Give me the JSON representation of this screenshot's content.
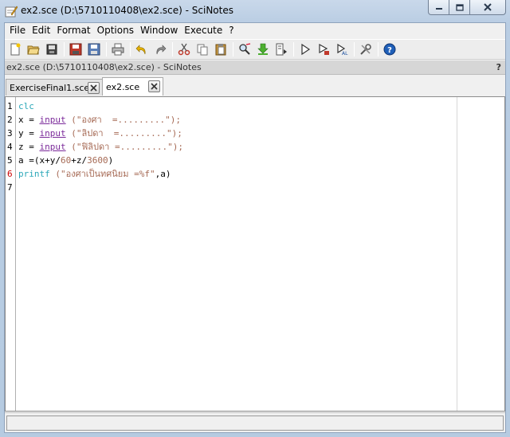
{
  "window": {
    "title": "ex2.sce (D:\\5710110408\\ex2.sce) - SciNotes"
  },
  "menu": [
    "File",
    "Edit",
    "Format",
    "Options",
    "Window",
    "Execute",
    "?"
  ],
  "toolbar_icons": [
    "new-file-icon",
    "open-file-icon",
    "open-recent-icon",
    "save-icon",
    "save-as-icon",
    "print-icon",
    "undo-icon",
    "redo-icon",
    "cut-icon",
    "copy-icon",
    "paste-icon",
    "find-icon",
    "load-into-scilab-icon",
    "execute-file-icon",
    "run-icon",
    "run-selection-icon",
    "run-to-cursor-icon",
    "settings-icon",
    "help-icon"
  ],
  "pathbar": {
    "path": "ex2.sce (D:\\5710110408\\ex2.sce) - SciNotes",
    "help": "?"
  },
  "tabs": [
    {
      "label": "ExerciseFinal1.sce",
      "active": false
    },
    {
      "label": "ex2.sce",
      "active": true
    }
  ],
  "editor": {
    "line_numbers": [
      "1",
      "2",
      "3",
      "4",
      "5",
      "6",
      "7"
    ],
    "lines": [
      [
        {
          "t": "clc",
          "c": "k-fn"
        }
      ],
      [
        {
          "t": "x",
          "c": "k-var"
        },
        {
          "t": " = ",
          "c": "k-op"
        },
        {
          "t": "input",
          "c": "k-ul"
        },
        {
          "t": " (\"องศา  =.........\");",
          "c": "k-str"
        }
      ],
      [
        {
          "t": "y",
          "c": "k-var"
        },
        {
          "t": " = ",
          "c": "k-op"
        },
        {
          "t": "input",
          "c": "k-ul"
        },
        {
          "t": " (\"ลิปดา  =.........\");",
          "c": "k-str"
        }
      ],
      [
        {
          "t": "z",
          "c": "k-var"
        },
        {
          "t": " = ",
          "c": "k-op"
        },
        {
          "t": "input",
          "c": "k-ul"
        },
        {
          "t": " (\"ฟิลิปดา =.........\");",
          "c": "k-str"
        }
      ],
      [
        {
          "t": "a",
          "c": "k-var"
        },
        {
          "t": " =",
          "c": "k-op"
        },
        {
          "t": "(x+y/",
          "c": "k-var"
        },
        {
          "t": "60",
          "c": "k-num"
        },
        {
          "t": "+z/",
          "c": "k-var"
        },
        {
          "t": "3600",
          "c": "k-num"
        },
        {
          "t": ")",
          "c": "k-var"
        }
      ],
      [
        {
          "t": "printf",
          "c": "k-fn"
        },
        {
          "t": " (\"องศาเป็นทศนิยม =%f\"",
          "c": "k-str"
        },
        {
          "t": ",a)",
          "c": "k-var"
        }
      ],
      []
    ]
  },
  "colors": {
    "line6_number": "#cc0000"
  }
}
